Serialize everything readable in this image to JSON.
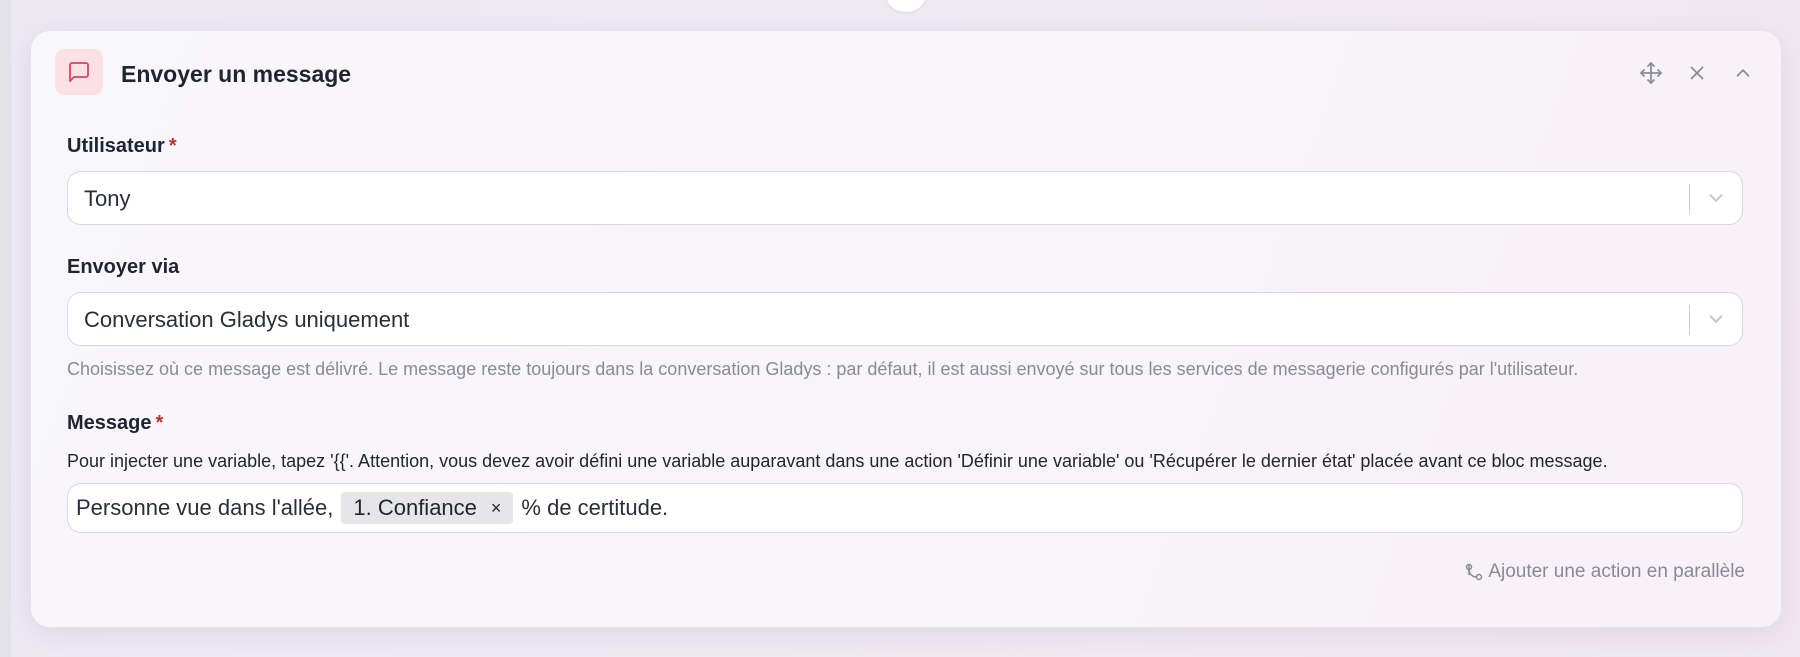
{
  "card": {
    "title": "Envoyer un message",
    "icons": {
      "header": "message-square-icon",
      "move": "move-arrows-icon",
      "close": "close-icon",
      "collapse": "chevron-up-icon"
    }
  },
  "user_field": {
    "label": "Utilisateur",
    "required_mark": "*",
    "value": "Tony"
  },
  "send_via_field": {
    "label": "Envoyer via",
    "value": "Conversation Gladys uniquement",
    "help": "Choisissez où ce message est délivré. Le message reste toujours dans la conversation Gladys : par défaut, il est aussi envoyé sur tous les services de messagerie configurés par l'utilisateur."
  },
  "message_field": {
    "label": "Message",
    "required_mark": "*",
    "info": "Pour injecter une variable, tapez '{{'. Attention, vous devez avoir défini une variable auparavant dans une action 'Définir une variable' ou 'Récupérer le dernier état' placée avant ce bloc message.",
    "text_before": "Personne vue dans l'allée,",
    "variable_tag": "1. Confiance",
    "variable_remove": "×",
    "text_after": "% de certitude."
  },
  "footer": {
    "parallel_action": "Ajouter une action en parallèle"
  },
  "colors": {
    "accent_icon_bg": "#fbe0e6",
    "accent_icon": "#d6455e",
    "required": "#c0302b"
  }
}
